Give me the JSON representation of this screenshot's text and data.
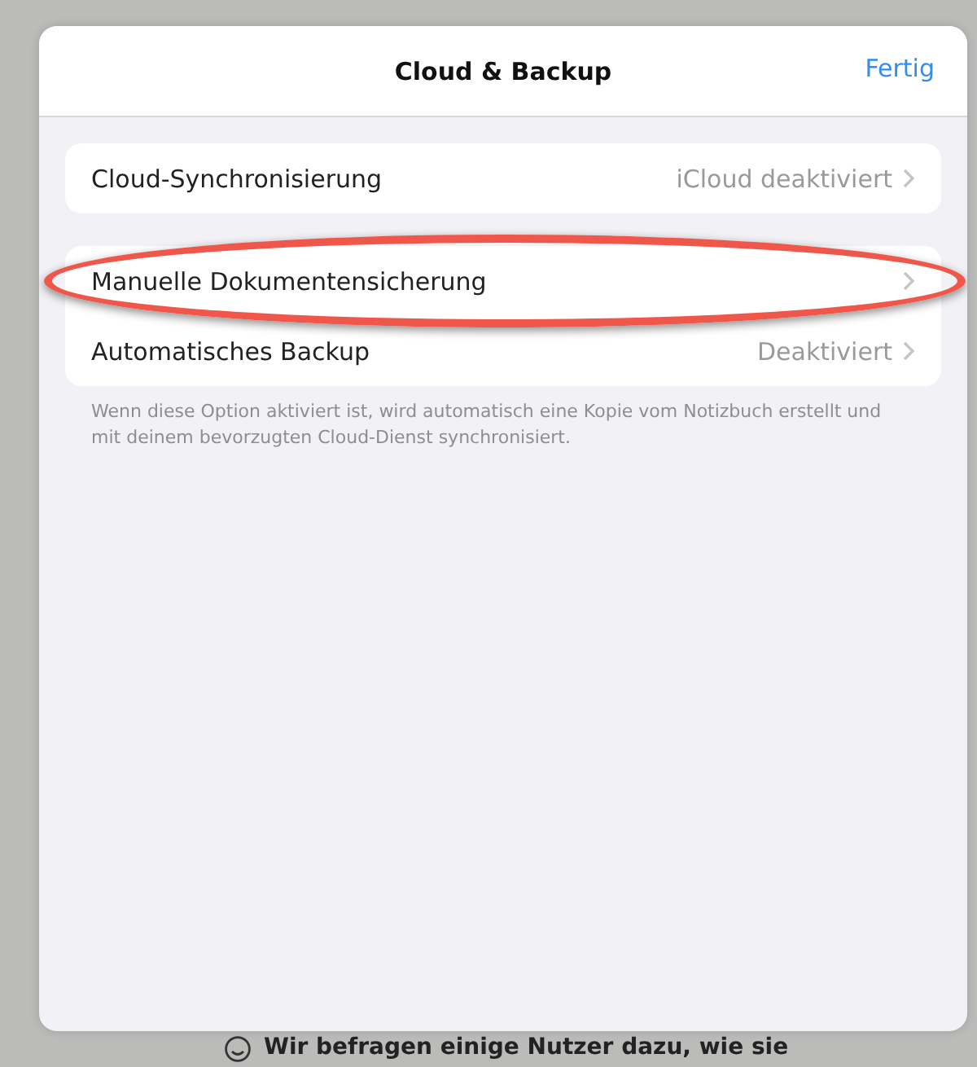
{
  "sheet": {
    "title": "Cloud & Backup",
    "done_button": "Fertig"
  },
  "groups": [
    {
      "rows": [
        {
          "label": "Cloud-Synchronisierung",
          "value": "iCloud deaktiviert",
          "highlighted": false
        }
      ]
    },
    {
      "rows": [
        {
          "label": "Manuelle Dokumentensicherung",
          "highlighted": true
        },
        {
          "label": "Automatisches Backup",
          "value": "Deaktiviert",
          "highlighted": false
        }
      ],
      "footer": "Wenn diese Option aktiviert ist, wird automatisch eine Kopie vom Notizbuch erstellt und mit deinem bevorzugten Cloud-Dienst synchronisiert."
    }
  ],
  "background": {
    "survey_text": "Wir befragen einige Nutzer dazu, wie sie"
  }
}
